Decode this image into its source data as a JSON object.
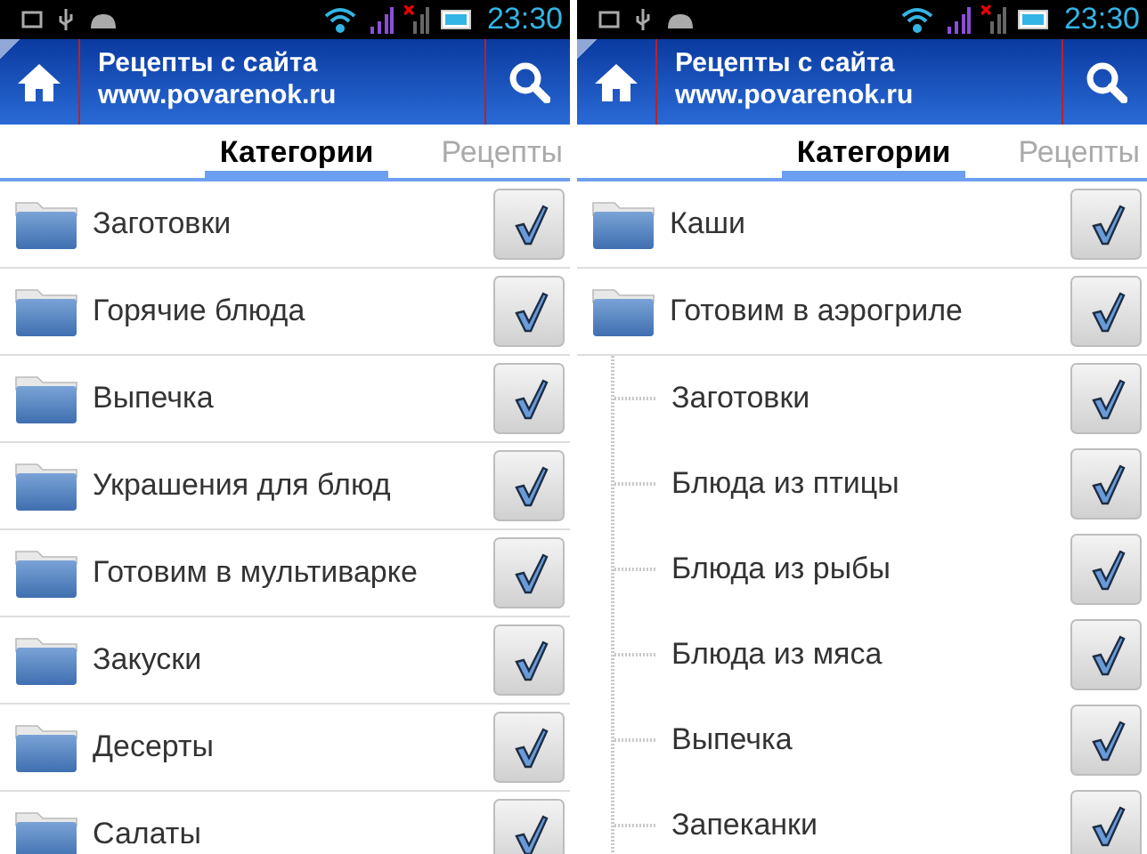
{
  "screens": [
    {
      "status_bar": {
        "time": "23:30"
      },
      "title_lines": [
        "Рецепты с сайта",
        "www.povarenok.ru"
      ],
      "tabs": [
        {
          "label": "Категории",
          "selected": true
        },
        {
          "label": "Рецепты",
          "selected": false
        }
      ],
      "categories": [
        {
          "label": "Заготовки",
          "checked": true
        },
        {
          "label": "Горячие блюда",
          "checked": true
        },
        {
          "label": "Выпечка",
          "checked": true
        },
        {
          "label": "Украшения для блюд",
          "checked": true
        },
        {
          "label": "Готовим в мультиварке",
          "checked": true
        },
        {
          "label": "Закуски",
          "checked": true
        },
        {
          "label": "Десерты",
          "checked": true
        },
        {
          "label": "Салаты",
          "checked": true
        }
      ]
    },
    {
      "status_bar": {
        "time": "23:30"
      },
      "title_lines": [
        "Рецепты с сайта",
        "www.povarenok.ru"
      ],
      "tabs": [
        {
          "label": "Категории",
          "selected": true
        },
        {
          "label": "Рецепты",
          "selected": false
        }
      ],
      "categories": [
        {
          "label": "Каши",
          "checked": true
        },
        {
          "label": "Готовим в аэрогриле",
          "checked": true,
          "children": [
            {
              "label": "Заготовки",
              "checked": true
            },
            {
              "label": "Блюда из птицы",
              "checked": true
            },
            {
              "label": "Блюда из рыбы",
              "checked": true
            },
            {
              "label": "Блюда из мяса",
              "checked": true
            },
            {
              "label": "Выпечка",
              "checked": true
            },
            {
              "label": "Запеканки",
              "checked": true
            }
          ]
        }
      ]
    }
  ]
}
